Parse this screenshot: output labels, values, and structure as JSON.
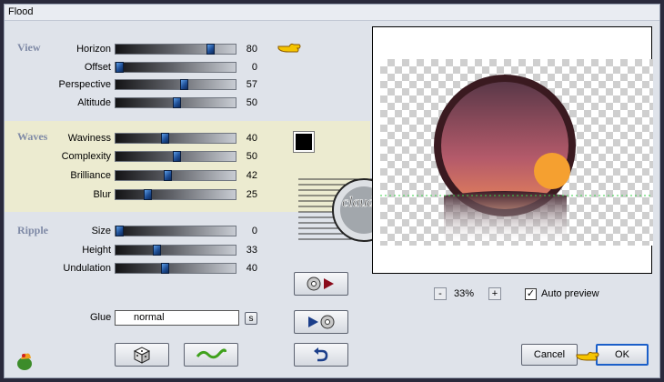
{
  "window": {
    "title": "Flood"
  },
  "groups": {
    "view": "View",
    "waves": "Waves",
    "ripple": "Ripple"
  },
  "params": [
    {
      "label": "Horizon",
      "value": 80
    },
    {
      "label": "Offset",
      "value": 0
    },
    {
      "label": "Perspective",
      "value": 57
    },
    {
      "label": "Altitude",
      "value": 50
    },
    {
      "label": "Waviness",
      "value": 40
    },
    {
      "label": "Complexity",
      "value": 50
    },
    {
      "label": "Brilliance",
      "value": 42
    },
    {
      "label": "Blur",
      "value": 25
    },
    {
      "label": "Size",
      "value": 0
    },
    {
      "label": "Height",
      "value": 33
    },
    {
      "label": "Undulation",
      "value": 40
    }
  ],
  "glue": {
    "label": "Glue",
    "value": "normal",
    "button": "s"
  },
  "zoom": {
    "minus": "-",
    "value": "33%",
    "plus": "+"
  },
  "auto_preview": {
    "label": "Auto preview",
    "checked": true
  },
  "buttons": {
    "cancel": "Cancel",
    "ok": "OK"
  },
  "watermark": {
    "text": "claudia"
  },
  "colors": {
    "swatch": "#000000",
    "slider_thumb": "#2a5fa8",
    "waves_band": "#ecebd0"
  }
}
